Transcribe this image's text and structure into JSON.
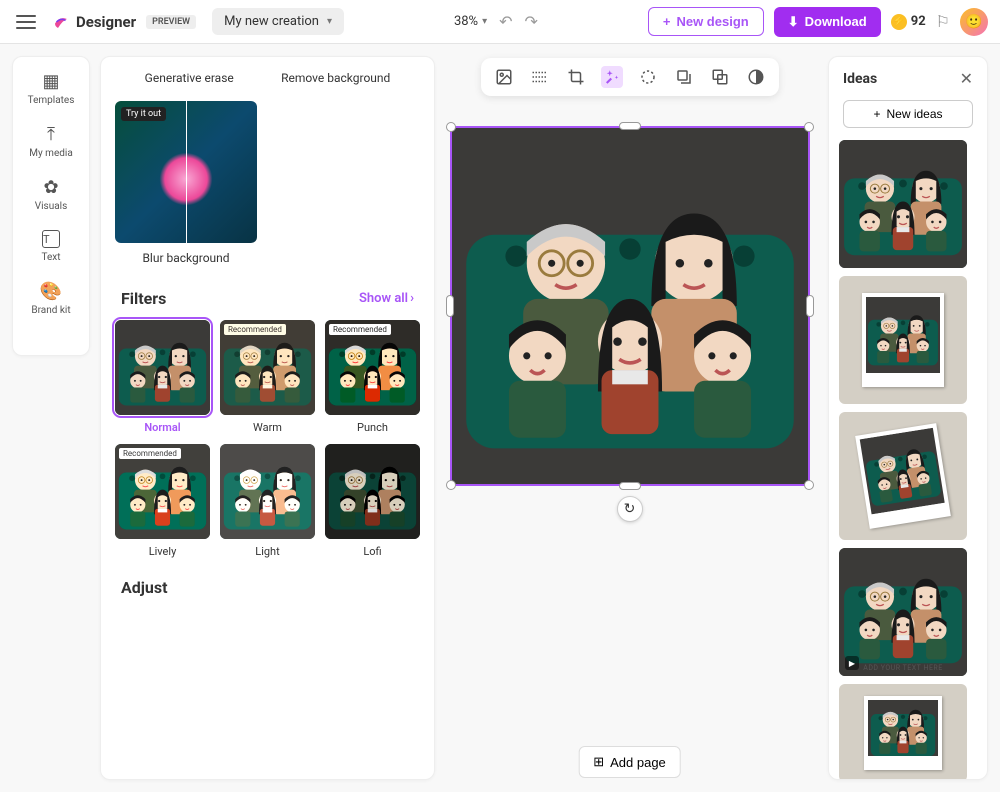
{
  "header": {
    "app_name": "Designer",
    "preview_badge": "PREVIEW",
    "project_name": "My new creation",
    "zoom": "38%",
    "new_design": "New design",
    "download": "Download",
    "credits": "92"
  },
  "rail": {
    "templates": "Templates",
    "my_media": "My media",
    "visuals": "Visuals",
    "text": "Text",
    "brand_kit": "Brand kit"
  },
  "panel": {
    "generative_erase": "Generative erase",
    "remove_background": "Remove background",
    "try_it_out": "Try it out",
    "blur_background": "Blur background",
    "filters_title": "Filters",
    "show_all": "Show all",
    "recommended": "Recommended",
    "filters": [
      {
        "label": "Normal",
        "selected": true,
        "rec": false
      },
      {
        "label": "Warm",
        "selected": false,
        "rec": true
      },
      {
        "label": "Punch",
        "selected": false,
        "rec": true
      },
      {
        "label": "Lively",
        "selected": false,
        "rec": true
      },
      {
        "label": "Light",
        "selected": false,
        "rec": false
      },
      {
        "label": "Lofi",
        "selected": false,
        "rec": false
      }
    ],
    "adjust_title": "Adjust"
  },
  "canvas": {
    "add_page": "Add page"
  },
  "ideas": {
    "title": "Ideas",
    "new_ideas": "New ideas",
    "card4_caption": "ADD YOUR TEXT HERE"
  }
}
